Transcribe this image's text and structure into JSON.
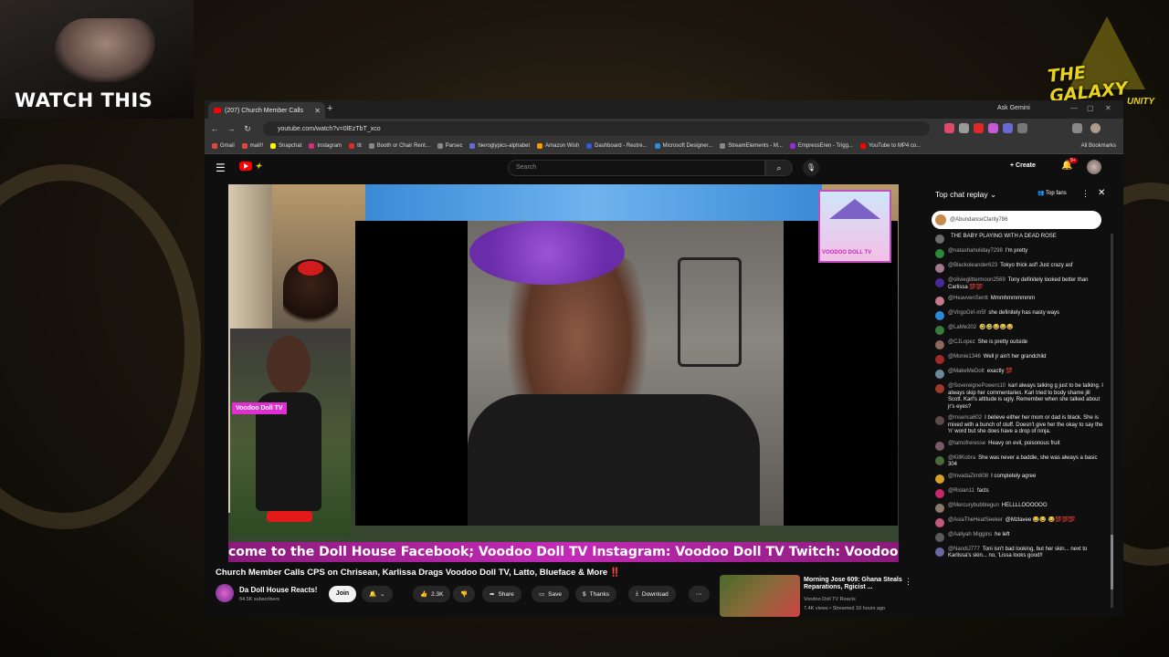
{
  "overlay": {
    "watch_label": "WATCH THIS",
    "galaxy_logo": "THE GALAXY",
    "galaxy_sub": "UNITY"
  },
  "browser": {
    "tab_title": "(207) Church Member Calls",
    "ask_label": "Ask Gemini",
    "url": "youtube.com/watch?v=0lEzTbT_xco",
    "bookmarks": [
      "Gmail",
      "mail!!",
      "Snapchat",
      "Instagram",
      "tit",
      "Booth or Chair Rent...",
      "Parsec",
      "hieroglypics-alphabet",
      "Amazon Wish",
      "Dashboard - Restre...",
      "Microsoft Designer...",
      "StreamElements - M...",
      "EmpressEren - Trigg...",
      "YouTube to MP4 co..."
    ],
    "all_bookmarks": "All Bookmarks"
  },
  "youtube": {
    "search_placeholder": "Search",
    "create_label": "Create",
    "notif_count": "9+",
    "video": {
      "overlay_tag": "Voodoo Doll TV",
      "logo_text": "VOODOO DOLL TV",
      "ticker": "come to the Doll House Facebook; Voodoo Doll TV Instagram: Voodoo Doll TV Twitch: Voodoo Doll"
    },
    "title": "Church Member Calls CPS on Chrisean, Karlissa Drags Voodoo Doll TV, Latto, Blueface & More ‼️",
    "channel": "Da Doll House Reacts!",
    "subscribers": "64.5K subscribers",
    "join": "Join",
    "likes": "2.3K",
    "share": "Share",
    "save": "Save",
    "thanks": "Thanks",
    "download": "Download",
    "recommended": {
      "title": "Morning Jose 609: Ghana Steals Reparations, Rgicist ...",
      "channel": "Voodoo Doll TV Reacts",
      "meta": "7.4K views • Streamed 10 hours ago"
    }
  },
  "chat": {
    "header": "Top chat replay",
    "top_fans": "Top fans",
    "pinned": "@AbundanceClarity786",
    "messages": [
      {
        "author": "",
        "text": "THE BABY PLAYING WITH A DEAD ROSE",
        "color": "#6b6b6b"
      },
      {
        "author": "@natashaholiday7298",
        "text": "I'm pretty",
        "color": "#2a8a3a"
      },
      {
        "author": "@Blackoleander623",
        "text": "Tokyo thick asf! Just crazy asf",
        "color": "#a07a8a"
      },
      {
        "author": "@olivieglittermoon2569",
        "text": "Tony definitely looked better than Carlissa 💯💯",
        "color": "#4a2a9a"
      },
      {
        "author": "@HeavvenSentt",
        "text": "Mmmhmmmmmm",
        "color": "#c47a8a"
      },
      {
        "author": "@VirgoGirl-m5f",
        "text": "she definitely has nasty ways",
        "color": "#2a8ad6"
      },
      {
        "author": "@LaMe202",
        "text": "🤣🤣😂😂😂",
        "color": "#3a7a3a"
      },
      {
        "author": "@CJLopez",
        "text": "She is pretty outside",
        "color": "#8a6a5a"
      },
      {
        "author": "@Monie1346",
        "text": "Well jr ain't her grandchild",
        "color": "#a02a2a"
      },
      {
        "author": "@MakeMeDolt",
        "text": "exactly 💯",
        "color": "#6a8a9a"
      },
      {
        "author": "@SovereignePowers10",
        "text": "karl always talking g just to be talking. I always skip her commentaries. Karl tried to body shame jill Scott. Karl's attitude is ugly. Remember when she talked about jr's eyes?",
        "color": "#9a3a2a"
      },
      {
        "author": "@mserica602",
        "text": "I believe either her mom or dad is black. She is mixed with a bunch of stuff. Doesn't give her the okay to say the 'n' word but she does have a drop of ninja.",
        "color": "#5a4a4a"
      },
      {
        "author": "@tamofreresse",
        "text": "Heavy on evil, poisonous fruit",
        "color": "#7a5a6a"
      },
      {
        "author": "@KillKobra",
        "text": "She was never a baddie, she was always a basic 304",
        "color": "#4a6a3a"
      },
      {
        "author": "@InvadaZim808",
        "text": "I completely agree",
        "color": "#d6a22a"
      },
      {
        "author": "@Rislan11",
        "text": "facts",
        "color": "#c42a6a"
      },
      {
        "author": "@Mercurybubblegun",
        "text": "HELLLLOOOOOO",
        "color": "#8a7a6a"
      },
      {
        "author": "@AsiaTheHeatSeeker",
        "text": "@Mzlavee 😂😂 😂💯💯💯",
        "color": "#c45a7a"
      },
      {
        "author": "@Aaliyah Miggins",
        "text": "he left",
        "color": "#5a5a5a"
      },
      {
        "author": "@NandiJ777",
        "text": "Toni isn't bad looking, but her skin... next to Karlissa's skin... no, 'Lissa looks good!!",
        "color": "#6a6aa2"
      }
    ]
  }
}
